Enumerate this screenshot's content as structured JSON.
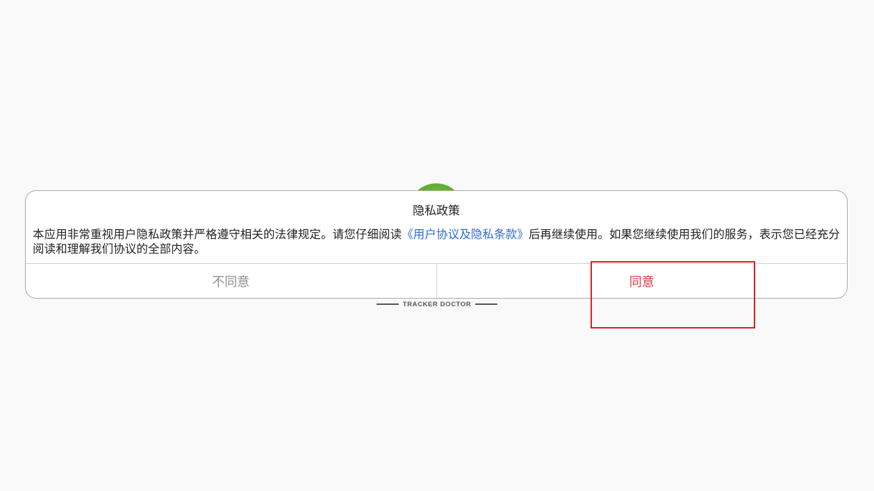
{
  "brand": {
    "name": "TRACKER DOCTOR",
    "logo_icon": "app-logo-icon",
    "logo_color": "#5aa52a"
  },
  "dialog": {
    "title": "隐私政策",
    "body_prefix": "本应用非常重视用户隐私政策并严格遵守相关的法律规定。请您仔细阅读",
    "body_link": "《用户协议及隐私条款》",
    "body_suffix": "后再继续使用。如果您继续使用我们的服务，表示您已经充分阅读和理解我们协议的全部内容。",
    "disagree_label": "不同意",
    "agree_label": "同意",
    "link_color": "#2f6bd4",
    "agree_color": "#e0383e",
    "disagree_color": "#8d8d8d"
  },
  "highlight": {
    "color": "#d81e1e",
    "target": "agree-button"
  }
}
